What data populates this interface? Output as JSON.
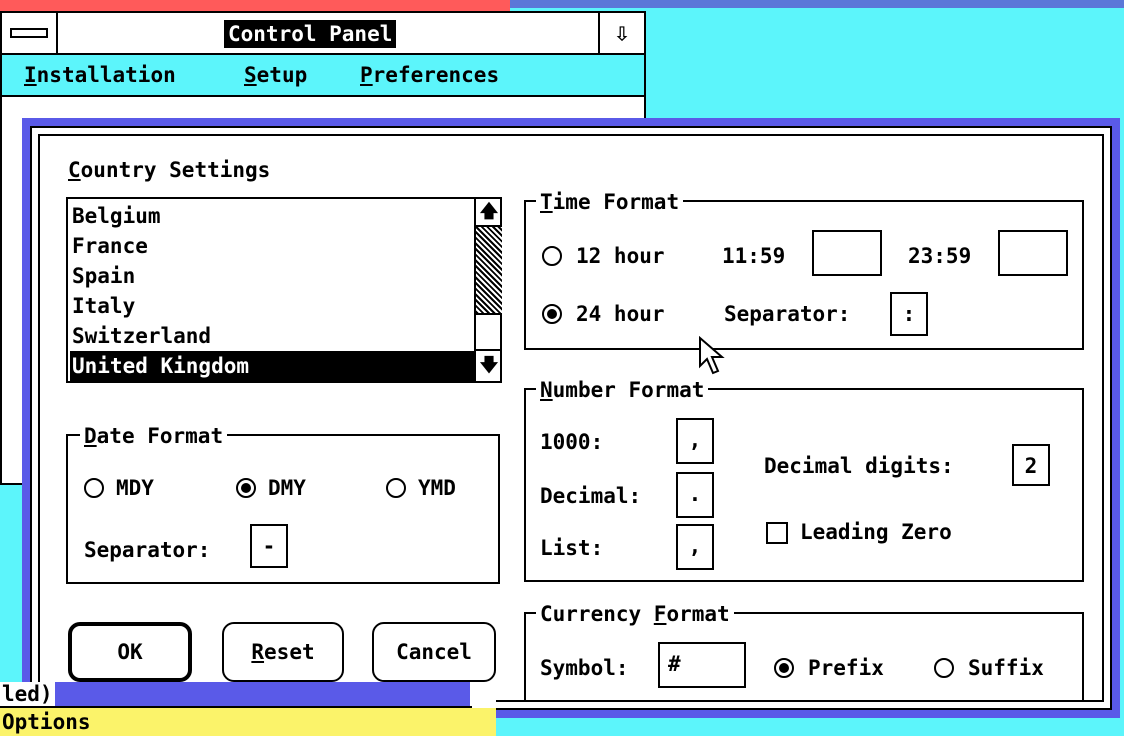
{
  "control_panel": {
    "title": "Control Panel",
    "max_icon": "⇩",
    "menu": [
      "Installation",
      "Setup",
      "Preferences"
    ]
  },
  "country_settings": {
    "label": "Country Settings",
    "countries": [
      "Belgium",
      "France",
      "Spain",
      "Italy",
      "Switzerland",
      "United Kingdom"
    ],
    "selected": "United Kingdom",
    "scroll_up_icon": "🡅",
    "scroll_down_icon": "🡇"
  },
  "date_format": {
    "label": "Date Format",
    "options": [
      "MDY",
      "DMY",
      "YMD"
    ],
    "selected": "DMY",
    "separator_label": "Separator:",
    "separator_value": "-"
  },
  "time_format": {
    "label": "Time Format",
    "option_12": "12 hour",
    "option_24": "24 hour",
    "selected": "24 hour",
    "am_label": "11:59",
    "am_value": "",
    "pm_label": "23:59",
    "pm_value": "",
    "separator_label": "Separator:",
    "separator_value": ":"
  },
  "number_format": {
    "label": "Number Format",
    "thousand_label": "1000:",
    "thousand_value": ",",
    "decimal_label": "Decimal:",
    "decimal_value": ".",
    "list_label": "List:",
    "list_value": ",",
    "decimal_digits_label": "Decimal digits:",
    "decimal_digits_value": "2",
    "leading_zero_label": "Leading Zero",
    "leading_zero_checked": false
  },
  "currency_format": {
    "label": "Currency Format",
    "symbol_label": "Symbol:",
    "symbol_value": "#",
    "prefix_label": "Prefix",
    "suffix_label": "Suffix",
    "selected": "Prefix"
  },
  "buttons": {
    "ok": "OK",
    "reset": "Reset",
    "cancel": "Cancel"
  },
  "background_window": {
    "title_fragment": "led)",
    "menu_fragment": "Options"
  },
  "colors": {
    "desktop": "#5cf5fb",
    "dialog_frame": "#5a5ae8",
    "menu_yellow": "#fbf36a"
  }
}
